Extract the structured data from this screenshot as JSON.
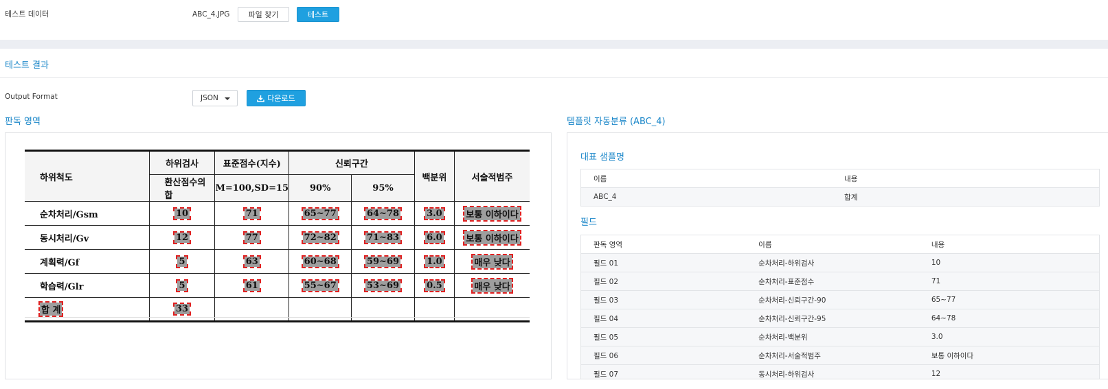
{
  "top": {
    "label": "테스트 데이터",
    "file_name": "ABC_4.JPG",
    "find_button": "파일 찾기",
    "test_button": "테스트"
  },
  "result": {
    "title": "테스트 결과",
    "output_format_label": "Output Format",
    "format_value": "JSON",
    "download_button": "다운로드"
  },
  "read_area": {
    "title": "판독 영역",
    "doc": {
      "h_col1": "하위척도",
      "h_col2a": "하위검사",
      "h_col2b": "환산점수의 합",
      "h_col3a": "표준점수(지수)",
      "h_col3b": "M=100,SD=15",
      "h_col4": "신뢰구간",
      "h_col4a": "90%",
      "h_col4b": "95%",
      "h_col5": "백분위",
      "h_col6": "서술적범주",
      "rows": [
        {
          "name": "순차처리/Gsm",
          "c1": "10",
          "c2": "71",
          "c3": "65~77",
          "c4": "64~78",
          "c5": "3.0",
          "c6": "보통 이하이다"
        },
        {
          "name": "동시처리/Gv",
          "c1": "12",
          "c2": "77",
          "c3": "72~82",
          "c4": "71~83",
          "c5": "6.0",
          "c6": "보통 이하이다"
        },
        {
          "name": "계획력/Gf",
          "c1": "5",
          "c2": "63",
          "c3": "60~68",
          "c4": "59~69",
          "c5": "1.0",
          "c6": "매우 낮다"
        },
        {
          "name": "학습력/Glr",
          "c1": "5",
          "c2": "61",
          "c3": "55~67",
          "c4": "53~69",
          "c5": "0.5",
          "c6": "매우 낮다"
        }
      ],
      "total_label": "합 계",
      "total_value": "33"
    }
  },
  "template": {
    "title": "템플릿 자동분류 (ABC_4)",
    "sample_title": "대표 샘플명",
    "sample_headers": [
      "이름",
      "내용"
    ],
    "sample_rows": [
      [
        "ABC_4",
        "합계"
      ]
    ],
    "field_title": "필드",
    "field_headers": [
      "판독 영역",
      "이름",
      "내용"
    ],
    "field_rows": [
      [
        "필드 01",
        "순차처리-하위검사",
        "10"
      ],
      [
        "필드 02",
        "순차처리-표준점수",
        "71"
      ],
      [
        "필드 03",
        "순차처리-신뢰구간-90",
        "65~77"
      ],
      [
        "필드 04",
        "순차처리-신뢰구간-95",
        "64~78"
      ],
      [
        "필드 05",
        "순차처리-백분위",
        "3.0"
      ],
      [
        "필드 06",
        "순차처리-서술적범주",
        "보통 이하이다"
      ],
      [
        "필드 07",
        "동시처리-하위검사",
        "12"
      ]
    ]
  }
}
